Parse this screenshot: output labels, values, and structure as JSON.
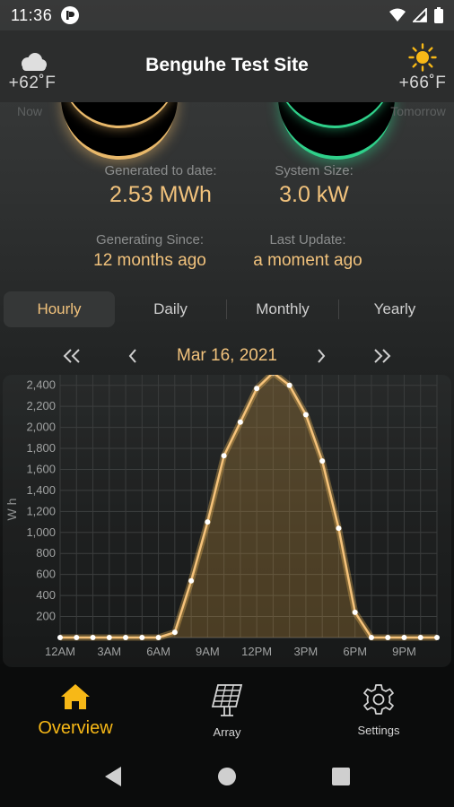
{
  "status_bar": {
    "time": "11:36"
  },
  "header": {
    "title": "Benguhe Test Site",
    "now": {
      "temp": "+62˚F",
      "label": "Now",
      "icon": "cloud-icon"
    },
    "tomorrow": {
      "temp": "+66˚F",
      "label": "Tomorrow",
      "icon": "sun-icon"
    }
  },
  "stats": {
    "generated_label": "Generated to date:",
    "generated_value": "2.53 MWh",
    "size_label": "System Size:",
    "size_value": "3.0 kW",
    "since_label": "Generating Since:",
    "since_value": "12 months ago",
    "update_label": "Last Update:",
    "update_value": "a moment ago"
  },
  "tabs": [
    {
      "label": "Hourly",
      "active": true
    },
    {
      "label": "Daily",
      "active": false
    },
    {
      "label": "Monthly",
      "active": false
    },
    {
      "label": "Yearly",
      "active": false
    }
  ],
  "date_nav": {
    "date": "Mar 16, 2021"
  },
  "colors": {
    "accent": "#f1c27c",
    "nav_active": "#f7b817",
    "green_glow": "#2fd08a"
  },
  "chart_data": {
    "type": "area",
    "ylabel": "Wh",
    "ylim": [
      0,
      2500
    ],
    "yticks": [
      200,
      400,
      600,
      800,
      1000,
      1200,
      1400,
      1600,
      1800,
      2000,
      2200,
      2400
    ],
    "ytick_labels": [
      "200",
      "400",
      "600",
      "800",
      "1,000",
      "1,200",
      "1,400",
      "1,600",
      "1,800",
      "2,000",
      "2,200",
      "2,400"
    ],
    "x_tick_labels": [
      "12AM",
      "3AM",
      "6AM",
      "9AM",
      "12PM",
      "3PM",
      "6PM",
      "9PM"
    ],
    "x": [
      "12:00AM",
      "1:00AM",
      "2:00AM",
      "3:00AM",
      "4:00AM",
      "5:00AM",
      "6:00AM",
      "7:00AM",
      "8:00AM",
      "9:00AM",
      "10:00AM",
      "11:00AM",
      "12:00PM",
      "1:00PM",
      "2:00PM",
      "3:00PM",
      "4:00PM",
      "5:00PM",
      "6:00PM",
      "7:00PM",
      "8:00PM",
      "9:00PM",
      "10:00PM",
      "11:00PM"
    ],
    "values": [
      0,
      0,
      0,
      0,
      0,
      0,
      0,
      50,
      540,
      1100,
      1730,
      2050,
      2370,
      2520,
      2400,
      2120,
      1680,
      1040,
      240,
      0,
      0,
      0,
      0,
      0
    ],
    "grid": true
  },
  "bottom_nav": [
    {
      "label": "Overview",
      "icon": "home-icon",
      "active": true
    },
    {
      "label": "Array",
      "icon": "solar-panel-icon",
      "active": false
    },
    {
      "label": "Settings",
      "icon": "gear-icon",
      "active": false
    }
  ]
}
